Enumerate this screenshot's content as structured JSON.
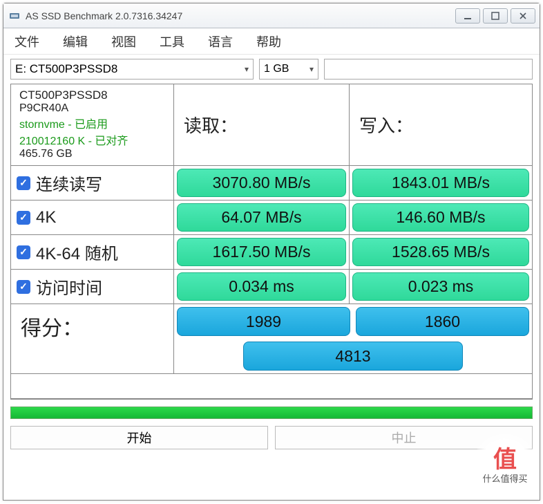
{
  "window": {
    "title": "AS SSD Benchmark 2.0.7316.34247"
  },
  "menu": {
    "file": "文件",
    "edit": "编辑",
    "view": "视图",
    "tools": "工具",
    "language": "语言",
    "help": "帮助"
  },
  "toolbar": {
    "drive": "E: CT500P3PSSD8",
    "size": "1 GB"
  },
  "device": {
    "name": "CT500P3PSSD8",
    "firmware": "P9CR40A",
    "driver": "stornvme - 已启用",
    "alignment": "210012160 K - 已对齐",
    "capacity": "465.76 GB"
  },
  "headers": {
    "read": "读取：",
    "write": "写入："
  },
  "tests": [
    {
      "label": "连续读写",
      "read": "3070.80 MB/s",
      "write": "1843.01 MB/s"
    },
    {
      "label": "4K",
      "read": "64.07 MB/s",
      "write": "146.60 MB/s"
    },
    {
      "label": "4K-64 随机",
      "read": "1617.50 MB/s",
      "write": "1528.65 MB/s"
    },
    {
      "label": "访问时间",
      "read": "0.034 ms",
      "write": "0.023 ms"
    }
  ],
  "score": {
    "label": "得分：",
    "read": "1989",
    "write": "1860",
    "total": "4813"
  },
  "buttons": {
    "start": "开始",
    "stop": "中止"
  },
  "watermark": {
    "brand_char": "值",
    "text": "什么值得买"
  }
}
